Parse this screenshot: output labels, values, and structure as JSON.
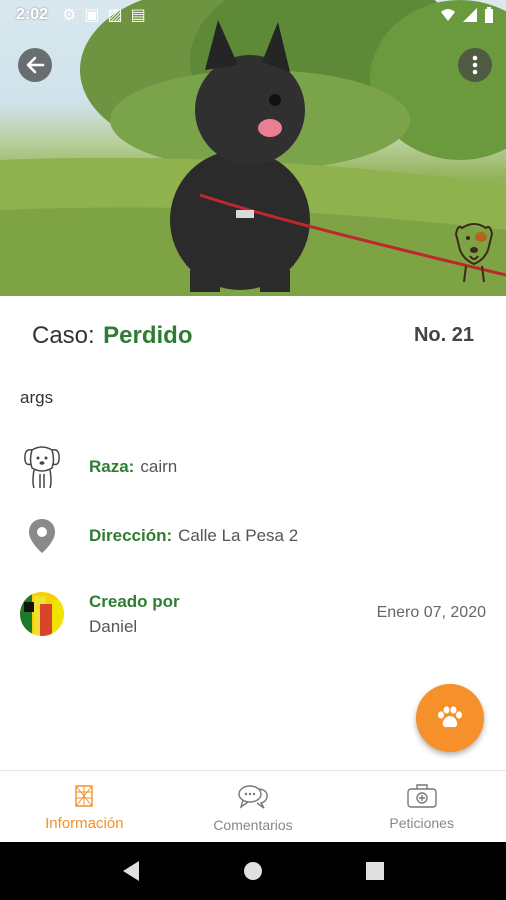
{
  "status_bar": {
    "time": "2:02"
  },
  "case": {
    "label": "Caso:",
    "status": "Perdido",
    "number": "No. 21"
  },
  "description": "args",
  "breed": {
    "label": "Raza:",
    "value": "cairn"
  },
  "address": {
    "label": "Dirección:",
    "value": "Calle La Pesa 2"
  },
  "creator": {
    "label": "Creado por",
    "name": "Daniel",
    "date": "Enero 07, 2020"
  },
  "bottom_nav": {
    "tabs": [
      {
        "label": "Información",
        "icon": "info-icon",
        "active": true
      },
      {
        "label": "Comentarios",
        "icon": "comments-icon",
        "active": false
      },
      {
        "label": "Peticiones",
        "icon": "requests-icon",
        "active": false
      }
    ]
  },
  "colors": {
    "accent": "#f5902a",
    "status": "#2e7d32"
  }
}
